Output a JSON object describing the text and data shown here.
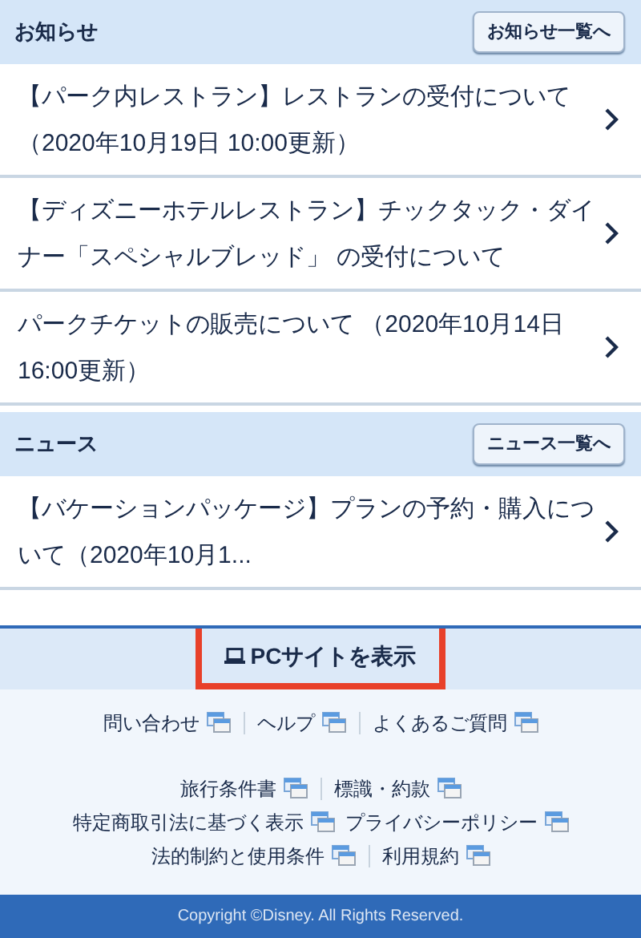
{
  "sections": [
    {
      "title": "お知らせ",
      "button": "お知らせ一覧へ",
      "items": [
        "【パーク内レストラン】レストランの受付について（2020年10月19日 10:00更新）",
        "【ディズニーホテルレストラン】チックタック・ダイナー「スペシャルブレッド」 の受付について",
        "パークチケットの販売について （2020年10月14日 16:00更新）"
      ]
    },
    {
      "title": "ニュース",
      "button": "ニュース一覧へ",
      "items": [
        "【バケーションパッケージ】プランの予約・購入について（2020年10月1..."
      ]
    }
  ],
  "pc_site": {
    "label": "PCサイトを表示",
    "highlighted": true
  },
  "footer_links": [
    [
      {
        "label": "問い合わせ",
        "divider_before": false
      },
      {
        "label": "ヘルプ",
        "divider_before": true
      },
      {
        "label": "よくあるご質問",
        "divider_before": true
      }
    ],
    [
      {
        "label": "旅行条件書",
        "divider_before": false
      },
      {
        "label": "標識・約款",
        "divider_before": true
      }
    ],
    [
      {
        "label": "特定商取引法に基づく表示",
        "divider_before": false
      },
      {
        "label": "プライバシーポリシー",
        "divider_before": false
      }
    ],
    [
      {
        "label": "法的制約と使用条件",
        "divider_before": false
      },
      {
        "label": "利用規約",
        "divider_before": true
      }
    ]
  ],
  "copyright": "Copyright ©Disney. All Rights Reserved."
}
